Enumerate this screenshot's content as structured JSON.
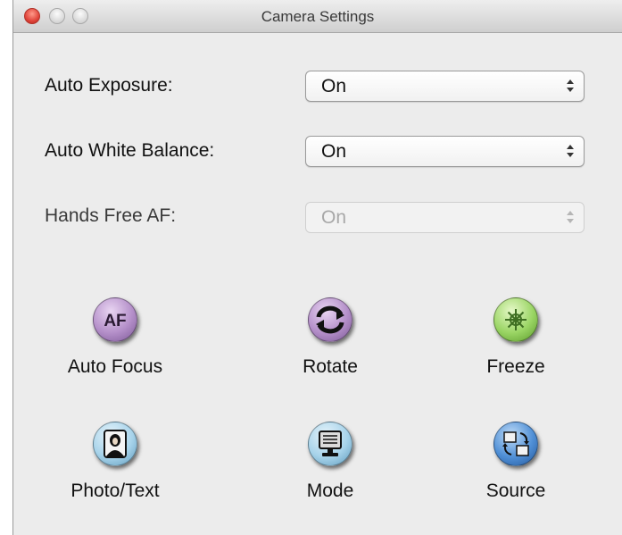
{
  "window": {
    "title": "Camera Settings"
  },
  "settings": [
    {
      "label": "Auto Exposure:",
      "value": "On",
      "enabled": true
    },
    {
      "label": "Auto White Balance:",
      "value": "On",
      "enabled": true
    },
    {
      "label": "Hands Free AF:",
      "value": "On",
      "enabled": false
    }
  ],
  "buttons": {
    "auto_focus": {
      "label": "Auto Focus",
      "icon_text": "AF",
      "icon": "af-icon",
      "color": "#b48fc9"
    },
    "rotate": {
      "label": "Rotate",
      "icon": "rotate-icon",
      "color": "#b48fc9"
    },
    "freeze": {
      "label": "Freeze",
      "icon": "freeze-icon",
      "color": "#9ad564"
    },
    "photo_text": {
      "label": "Photo/Text",
      "icon": "portrait-icon",
      "color": "#a7d3ea"
    },
    "mode": {
      "label": "Mode",
      "icon": "monitor-icon",
      "color": "#a7d3ea"
    },
    "source": {
      "label": "Source",
      "icon": "source-switch-icon",
      "color": "#4f8fd6"
    }
  }
}
